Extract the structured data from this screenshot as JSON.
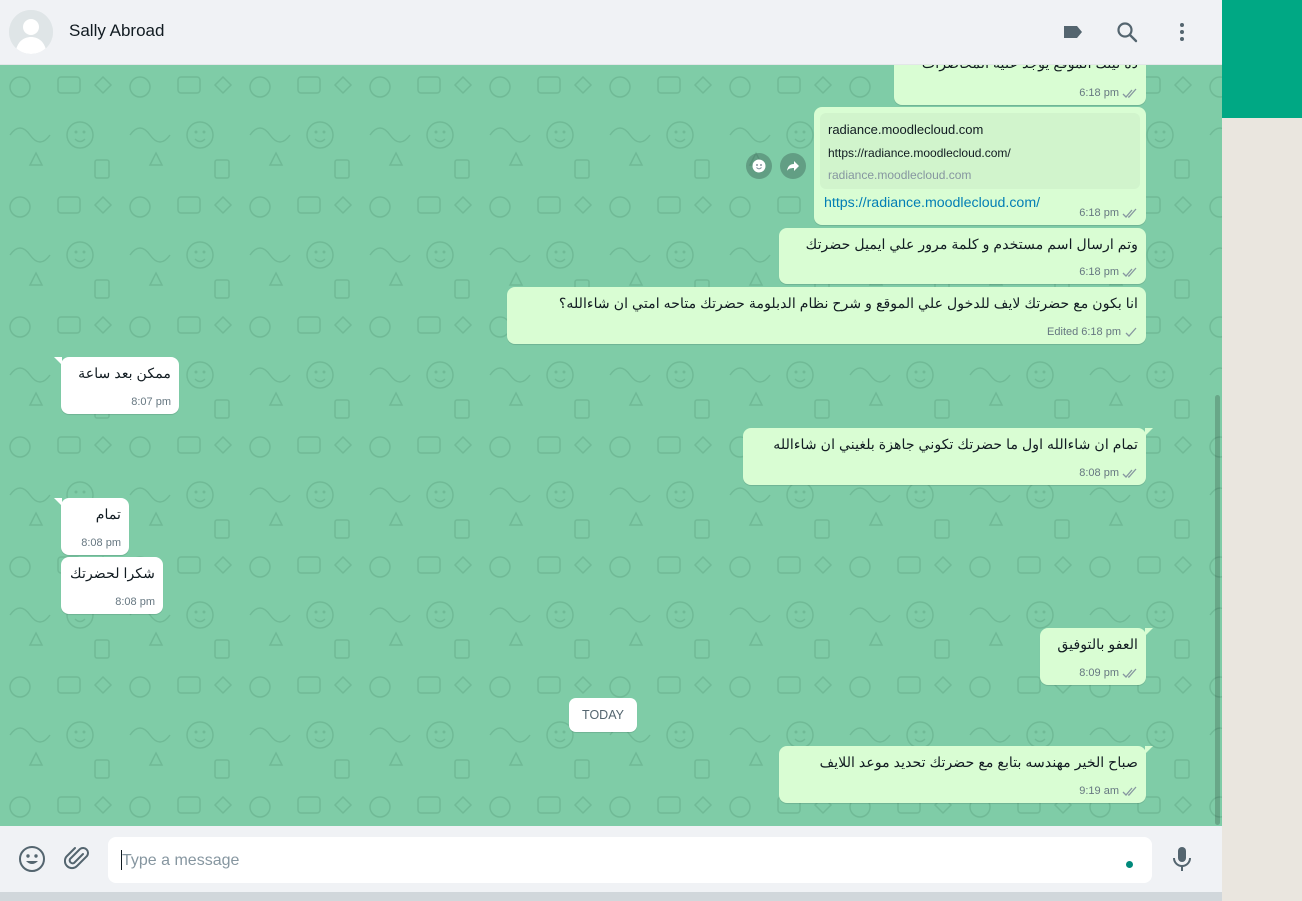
{
  "header": {
    "contact_name": "Sally Abroad"
  },
  "messages": [
    {
      "id": "m1",
      "dir": "out",
      "text": "ده لينك الموقع يوجد عليه المحاضرات",
      "time": "6:18 pm",
      "ticks": "double"
    },
    {
      "id": "m2",
      "dir": "out",
      "type": "link",
      "link_title": "radiance.moodlecloud.com",
      "link_url": "https://radiance.moodlecloud.com/",
      "link_domain": "radiance.moodlecloud.com",
      "text": "https://radiance.moodlecloud.com/",
      "time": "6:18 pm",
      "ticks": "double"
    },
    {
      "id": "m3",
      "dir": "out",
      "text": "وتم ارسال اسم مستخدم و كلمة مرور علي ايميل حضرتك",
      "time": "6:18 pm",
      "ticks": "double"
    },
    {
      "id": "m4",
      "dir": "out",
      "text": "انا بكون مع حضرتك لايف للدخول علي الموقع و شرح نظام الدبلومة حضرتك متاحه امتي ان شاءالله؟",
      "edited_label": "Edited",
      "time": "6:18 pm",
      "ticks": "single"
    },
    {
      "id": "m5",
      "dir": "in",
      "text": "ممكن بعد ساعة",
      "time": "8:07 pm"
    },
    {
      "id": "m6",
      "dir": "out",
      "text": "تمام ان شاءالله اول ما حضرتك تكوني جاهزة بلغيني ان شاءالله",
      "time": "8:08 pm",
      "ticks": "double"
    },
    {
      "id": "m7",
      "dir": "in",
      "text": "تمام",
      "time": "8:08 pm"
    },
    {
      "id": "m8",
      "dir": "in",
      "text": "شكرا لحضرتك",
      "time": "8:08 pm"
    },
    {
      "id": "m9",
      "dir": "out",
      "text": "العفو بالتوفيق",
      "time": "8:09 pm",
      "ticks": "double"
    },
    {
      "id": "m10",
      "dir": "out",
      "text": "صباح الخير مهندسه بتابع مع حضرتك تحديد موعد اللايف",
      "time": "9:19 am",
      "ticks": "double"
    }
  ],
  "day_divider": "TODAY",
  "composer": {
    "placeholder": "Type a message"
  },
  "colors": {
    "chat_background": "#7fcca7",
    "outgoing_bubble": "#d9fdd3",
    "incoming_bubble": "#ffffff",
    "accent": "#00a884",
    "link": "#027eb5"
  },
  "icons": {
    "header": [
      "label-icon",
      "search-icon",
      "menu-dots-icon"
    ],
    "footer": [
      "emoji-icon",
      "attach-icon",
      "mic-icon"
    ],
    "message_actions": [
      "emoji-react-icon",
      "forward-icon"
    ]
  }
}
